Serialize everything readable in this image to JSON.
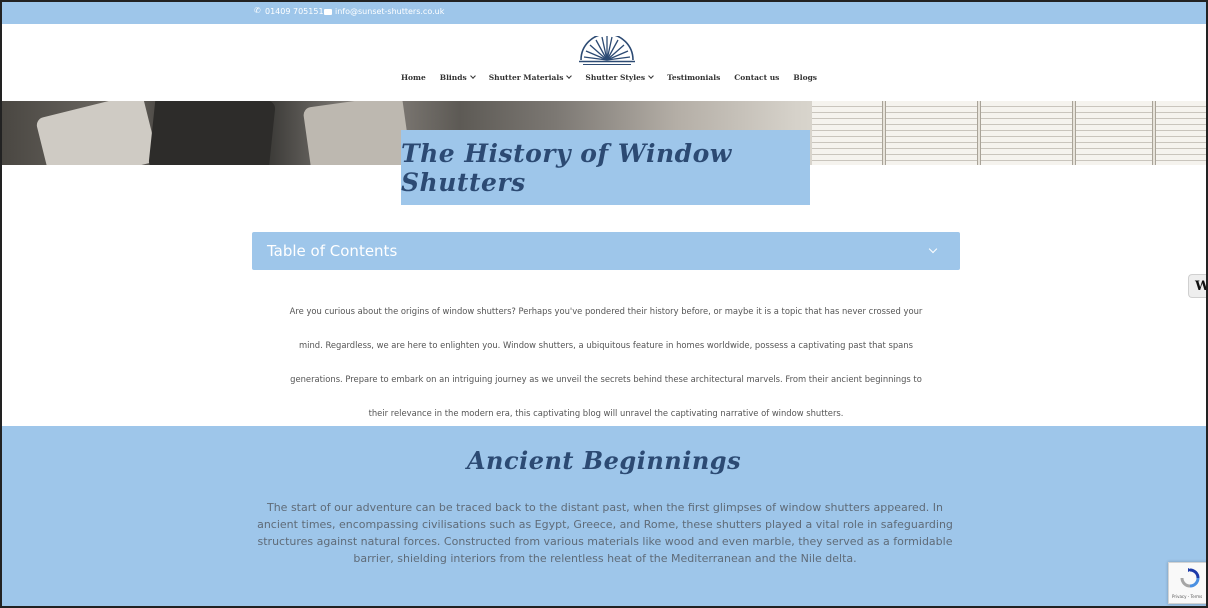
{
  "topbar": {
    "phone": "01409 705151",
    "email": "info@sunset-shutters.co.uk"
  },
  "nav": {
    "items": [
      {
        "label": "Home"
      },
      {
        "label": "Blinds"
      },
      {
        "label": "Shutter Materials"
      },
      {
        "label": "Shutter Styles"
      },
      {
        "label": "Testimonials"
      },
      {
        "label": "Contact us"
      },
      {
        "label": "Blogs"
      }
    ]
  },
  "hero": {
    "title": "The History of Window Shutters"
  },
  "toc": {
    "title": "Table of Contents"
  },
  "intro": {
    "lines": [
      "Are you curious about the origins of window shutters? Perhaps you've pondered their history before, or maybe it is a topic that has never crossed your",
      "mind. Regardless, we are here to enlighten you. Window shutters, a ubiquitous feature in homes worldwide, possess a captivating past that spans",
      "generations. Prepare to embark on an intriguing journey as we unveil the secrets behind these architectural marvels. From their ancient beginnings to",
      "their relevance in the modern era, this captivating blog will unravel the captivating narrative of window shutters."
    ]
  },
  "ancient": {
    "heading": "Ancient Beginnings",
    "lines": [
      "The start of our adventure can be traced back to the distant past, when the first glimpses of window shutters appeared. In",
      "ancient times, encompassing civilisations such as Egypt, Greece, and Rome, these shutters played a vital role in safeguarding",
      "structures against natural forces. Constructed from various materials like wood and even marble, they served as a formidable",
      "barrier, shielding interiors from the relentless heat of the Mediterranean and the Nile delta."
    ]
  },
  "side_widget": {
    "label": "W"
  },
  "recaptcha": {
    "label": "Privacy - Terms"
  },
  "colors": {
    "accent": "#9ec6ea",
    "heading_script": "#2c4a73",
    "body_text": "#555555"
  }
}
